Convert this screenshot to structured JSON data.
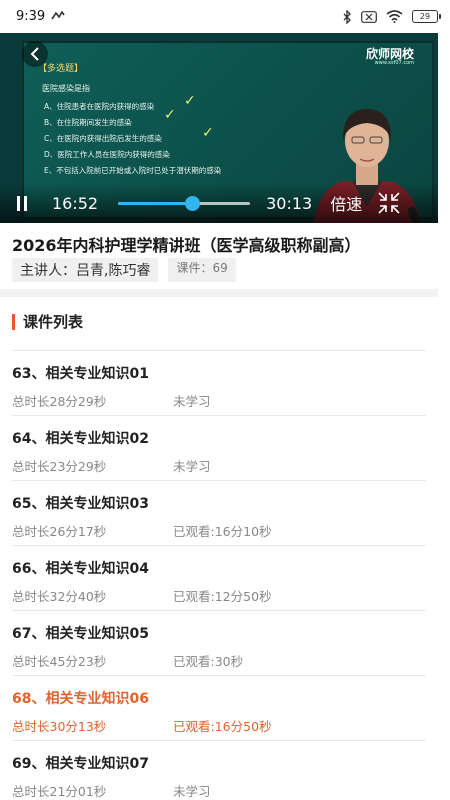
{
  "status_bar": {
    "time": "9:39",
    "battery": "29",
    "icons": [
      "bluetooth-icon",
      "mute-icon",
      "wifi-icon",
      "battery-icon"
    ]
  },
  "player": {
    "slide": {
      "tag": "【多选题】",
      "question": "医院感染是指",
      "options": [
        "A、住院患者在医院内获得的感染",
        "B、在住院期间发生的感染",
        "C、在医院内获得出院后发生的感染",
        "D、医院工作人员在医院内获得的感染",
        "E、不包括入院前已开始或入院时已处于潜伏期的感染"
      ]
    },
    "watermark": "欣师网校",
    "watermark_url": "www.xsf07.com",
    "current_time": "16:52",
    "total_time": "30:13",
    "progress": 0.56,
    "speed_label": "倍速",
    "accent_color": "#31b4f0"
  },
  "course": {
    "title": "2026年内科护理学精讲班（医学高级职称副高）",
    "lecturer": "主讲人：吕青,陈巧睿",
    "count": "课件：69"
  },
  "list": {
    "header": "课件列表",
    "accent_color": "#e2622b",
    "lessons": [
      {
        "title": "63、相关专业知识01",
        "duration": "总时长28分29秒",
        "status": "未学习",
        "active": false
      },
      {
        "title": "64、相关专业知识02",
        "duration": "总时长23分29秒",
        "status": "未学习",
        "active": false
      },
      {
        "title": "65、相关专业知识03",
        "duration": "总时长26分17秒",
        "status": "已观看:16分10秒",
        "active": false
      },
      {
        "title": "66、相关专业知识04",
        "duration": "总时长32分40秒",
        "status": "已观看:12分50秒",
        "active": false
      },
      {
        "title": "67、相关专业知识05",
        "duration": "总时长45分23秒",
        "status": "已观看:30秒",
        "active": false
      },
      {
        "title": "68、相关专业知识06",
        "duration": "总时长30分13秒",
        "status": "已观看:16分50秒",
        "active": true
      },
      {
        "title": "69、相关专业知识07",
        "duration": "总时长21分01秒",
        "status": "未学习",
        "active": false
      }
    ]
  }
}
